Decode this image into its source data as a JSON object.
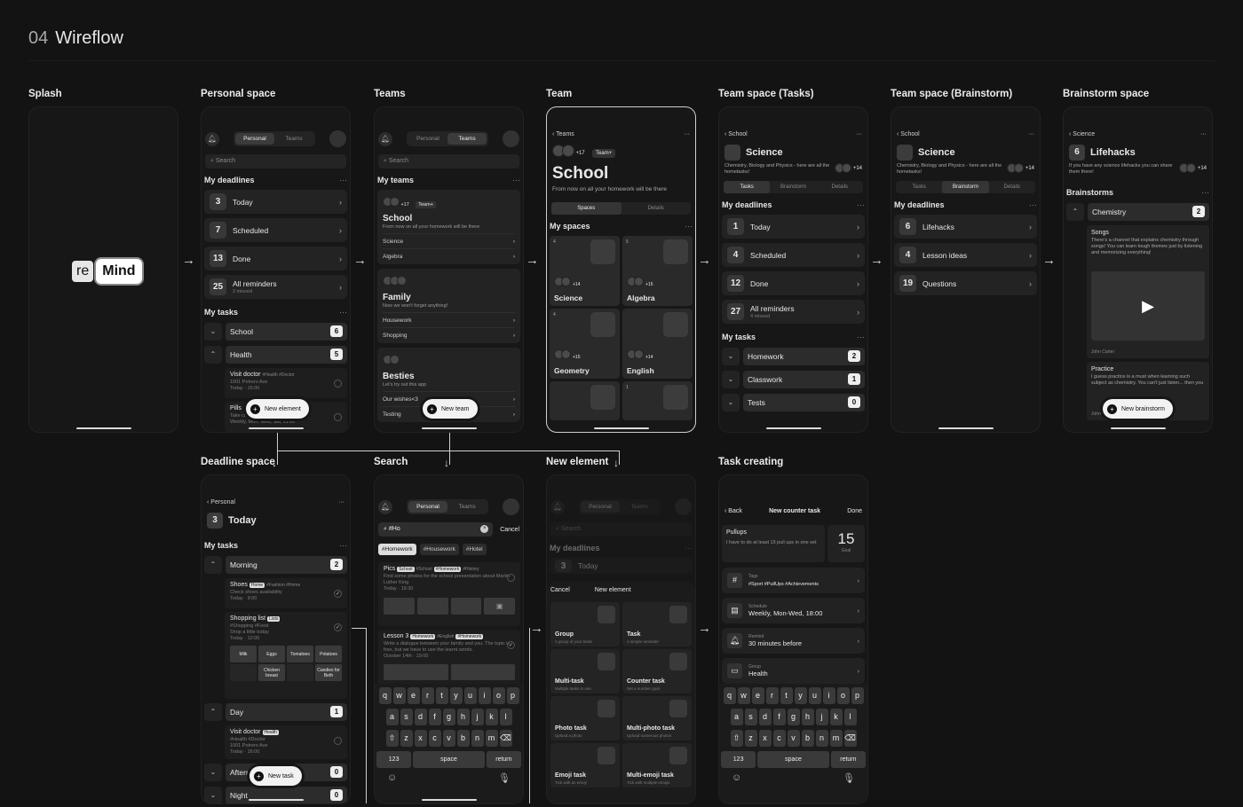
{
  "header": {
    "number": "04",
    "title": "Wireflow"
  },
  "labels": {
    "splash": "Splash",
    "personal": "Personal space",
    "teams": "Teams",
    "team": "Team",
    "tasks": "Team space (Tasks)",
    "brain": "Team space (Brainstorm)",
    "bspace": "Brainstorm space",
    "deadline": "Deadline space",
    "search": "Search",
    "newel": "New element",
    "creating": "Task creating"
  },
  "common": {
    "personal": "Personal",
    "teams": "Teams",
    "search": "Search",
    "my_deadlines": "My deadlines",
    "my_tasks": "My tasks",
    "my_teams": "My teams",
    "my_spaces": "My spaces",
    "dots": "···"
  },
  "splash": {
    "logo_a": "re",
    "logo_b": "Mind"
  },
  "personal": {
    "deadlines": [
      {
        "n": "3",
        "label": "Today",
        "sub": ""
      },
      {
        "n": "7",
        "label": "Scheduled",
        "sub": ""
      },
      {
        "n": "13",
        "label": "Done",
        "sub": ""
      },
      {
        "n": "25",
        "label": "All reminders",
        "sub": "2 missed"
      }
    ],
    "tasks": [
      {
        "label": "School",
        "count": "6",
        "car": "⌄"
      },
      {
        "label": "Health",
        "count": "5",
        "car": "⌃"
      }
    ],
    "item1": {
      "title": "Visit doctor",
      "tags": "#Health  #Doctor",
      "addr": "1001 Potrero Ave",
      "time": "Today · 15:00"
    },
    "item2": {
      "title": "Pills",
      "d1": "Take cream",
      "d2": "Weekly, Mon, Wed, Sat, 11:00"
    },
    "pill": "New element"
  },
  "teams": {
    "school": {
      "count": "+17",
      "badge": "Team+",
      "title": "School",
      "sub": "From now on all your homework will be there",
      "l1": "Science",
      "l2": "Algebra"
    },
    "family": {
      "title": "Family",
      "sub": "Now we won't forget anything!",
      "l1": "Housework",
      "l2": "Shopping"
    },
    "besties": {
      "title": "Besties",
      "sub": "Let's try out this app",
      "l1": "Our wishes<3",
      "l2": "Testing"
    },
    "pill": "New team"
  },
  "team": {
    "back": "Teams",
    "count": "+17",
    "badge": "Team+",
    "title": "School",
    "desc": "From now on all your homework will be there",
    "tab1": "Spaces",
    "tab2": "Details",
    "spaces": [
      {
        "n": "4",
        "name": "Science",
        "cnt": "+14"
      },
      {
        "n": "5",
        "name": "Algebra",
        "cnt": "+15"
      },
      {
        "n": "4",
        "name": "Geometry",
        "cnt": "+15"
      },
      {
        "n": "",
        "name": "English",
        "cnt": "+14"
      },
      {
        "n": "",
        "name": "",
        "cnt": ""
      },
      {
        "n": "1",
        "name": "",
        "cnt": ""
      }
    ]
  },
  "ts_tasks": {
    "back": "School",
    "title": "Science",
    "desc": "Chemistry, Biology and Physics - here are all the hometasks!",
    "cnt": "+14",
    "tab1": "Tasks",
    "tab2": "Brainstorm",
    "tab3": "Details",
    "deadlines": [
      {
        "n": "1",
        "label": "Today",
        "sub": ""
      },
      {
        "n": "4",
        "label": "Scheduled",
        "sub": ""
      },
      {
        "n": "12",
        "label": "Done",
        "sub": ""
      },
      {
        "n": "27",
        "label": "All reminders",
        "sub": "4 missed"
      }
    ],
    "tasks": [
      {
        "label": "Homework",
        "count": "2"
      },
      {
        "label": "Classwork",
        "count": "1"
      },
      {
        "label": "Tests",
        "count": "0"
      }
    ]
  },
  "ts_brain": {
    "back": "School",
    "title": "Science",
    "desc": "Chemistry, Biology and Physics - here are all the hometasks!",
    "cnt": "+14",
    "deadlines": [
      {
        "n": "6",
        "label": "Lifehacks"
      },
      {
        "n": "4",
        "label": "Lesson ideas"
      },
      {
        "n": "19",
        "label": "Questions"
      }
    ]
  },
  "bspace": {
    "back": "Science",
    "n": "6",
    "title": "Lifehacks",
    "desc": "If you have any science lifehacks you can share them there!",
    "cnt": "+14",
    "section": "Brainstorms",
    "chem": "Chemistry",
    "chem_count": "2",
    "songs_title": "Songs",
    "songs_text": "There's a channel that explains chemistry through songs! You can learn tough themes just by listening and memorizing everything!",
    "author": "John Carter",
    "practice_title": "Practice",
    "practice_text": "I guess practice is a must when learning such subject as chemistry. You can't just listen... then you",
    "author2": "John Carter",
    "pill": "New brainstorm"
  },
  "deadline": {
    "back": "Personal",
    "n": "3",
    "title": "Today",
    "morning": "Morning",
    "morning_count": "2",
    "shoes": {
      "title": "Shoes",
      "tag": "Home",
      "tags": "#Fashion  #Home",
      "d1": "Check shoes availability",
      "d2": "Today · 9:00"
    },
    "shopping": {
      "title": "Shopping list",
      "tag": "Lists",
      "tags": "#Shopping  #Food",
      "d1": "Shop a little today",
      "d2": "Today · 12:00"
    },
    "items": [
      "Milk",
      "Eggs",
      "Tomatoes",
      "Potatoes",
      "",
      "Chicken breast",
      "",
      "Candies for Beth"
    ],
    "day": "Day",
    "day_count": "1",
    "visit": {
      "title": "Visit doctor",
      "tag": "Health",
      "tags": "#Health  #Doctor",
      "d1": "1001 Potrero Ave",
      "d2": "Today · 16:00"
    },
    "after": "Afternoon",
    "after_count": "0",
    "night": "Night",
    "night_count": "0",
    "pill": "New task"
  },
  "search": {
    "query": "#Ho",
    "cancel": "Cancel",
    "chips": [
      "#Homework",
      "#Housework",
      "#Hotel"
    ],
    "r1": {
      "title": "Pics",
      "tag1": "School",
      "tags": "#School",
      "tag2": "#Homework",
      "tags2": "#History",
      "d": "Find some photos for the school presentation about Martin Luther King",
      "t": "Today · 19:30"
    },
    "r2": {
      "title": "Lesson 3",
      "tag1": "Homework",
      "tags": "#English",
      "tag2": "#Homework",
      "d": "Write a dialogue between your family and you. The topic is free, but we have to use the learnt words.",
      "t": "October 14th · 19:00"
    }
  },
  "keyboard": {
    "r1": [
      "q",
      "w",
      "e",
      "r",
      "t",
      "y",
      "u",
      "i",
      "o",
      "p"
    ],
    "r2": [
      "a",
      "s",
      "d",
      "f",
      "g",
      "h",
      "j",
      "k",
      "l"
    ],
    "r3": [
      "z",
      "x",
      "c",
      "v",
      "b",
      "n",
      "m"
    ],
    "k123": "123",
    "space": "space",
    "ret": "return"
  },
  "newel": {
    "today_n": "3",
    "today": "Today",
    "cancel": "Cancel",
    "title": "New element",
    "opts": [
      {
        "name": "Group",
        "desc": "A group of your tasks"
      },
      {
        "name": "Task",
        "desc": "A simple reminder"
      },
      {
        "name": "Multi-task",
        "desc": "Multiple tasks in one"
      },
      {
        "name": "Counter task",
        "desc": "Set a number goal"
      },
      {
        "name": "Photo task",
        "desc": "Upload a photo"
      },
      {
        "name": "Multi-photo task",
        "desc": "Upload numerous photos"
      },
      {
        "name": "Emoji task",
        "desc": "Tick with an emoji"
      },
      {
        "name": "Multi-emoji task",
        "desc": "Tick with multiple emojis"
      }
    ]
  },
  "creating": {
    "back": "Back",
    "title": "New counter task",
    "done": "Done",
    "name": "Pullups",
    "desc": "I have to do at least 15 pull ups in one set",
    "goal": "15",
    "goal_label": "Goal",
    "tags_label": "Tags",
    "tags": "#Sport  #PullUps  #Achievements",
    "sched_label": "Schedule",
    "sched": "Weekly, Mon-Wed, 18:00",
    "rem_label": "Remind",
    "rem": "30 minutes before",
    "grp_label": "Group",
    "grp": "Health"
  }
}
